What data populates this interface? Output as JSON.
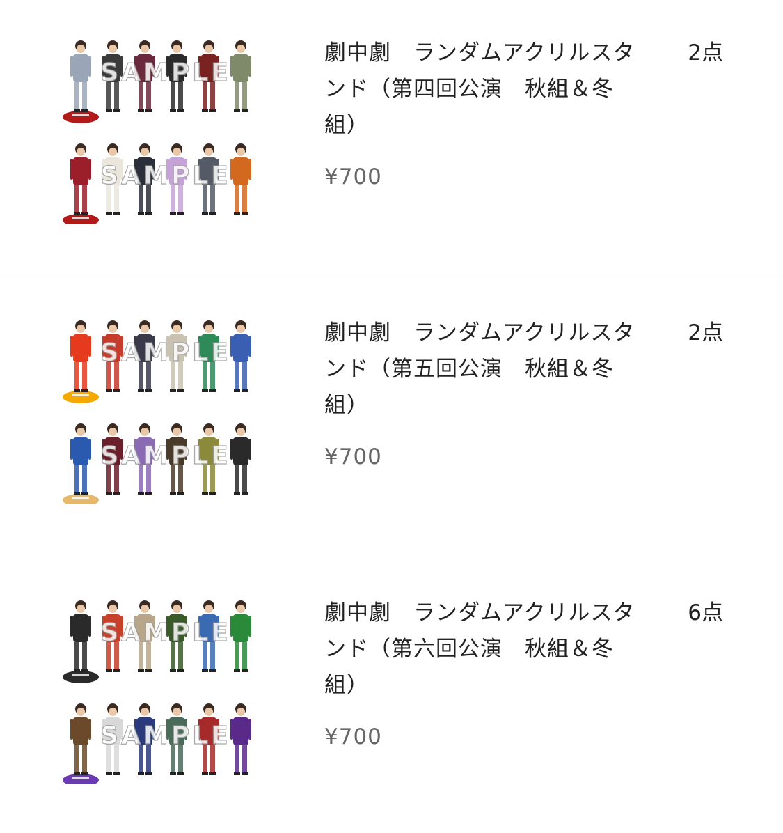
{
  "cart": {
    "items": [
      {
        "title": "劇中劇　ランダムアクリルスタンド（第四回公演　秋組＆冬組）",
        "quantity": "2点",
        "price": "¥700",
        "watermark": "SAMPLE",
        "base_colors": [
          "#b21a1a",
          "#b21a1a"
        ],
        "figure_colors": [
          [
            "#9aa6b8",
            "#3b3b3b",
            "#6b2a3b",
            "#2b2b2b",
            "#7a2222",
            "#7f8a6a"
          ],
          [
            "#9a1f2a",
            "#eae6dc",
            "#2b2f3a",
            "#c5a3d6",
            "#545a66",
            "#d2691e"
          ]
        ]
      },
      {
        "title": "劇中劇　ランダムアクリルスタンド（第五回公演　秋組＆冬組）",
        "quantity": "2点",
        "price": "¥700",
        "watermark": "SAMPLE",
        "base_colors": [
          "#f5a800",
          "#e6b96a"
        ],
        "figure_colors": [
          [
            "#e63a1f",
            "#c63b2b",
            "#3a3a4a",
            "#c9c2b2",
            "#2f8a5a",
            "#3a5fb2"
          ],
          [
            "#2a5ab0",
            "#6a1f2a",
            "#8a6ab2",
            "#4a3a2a",
            "#8a8a3a",
            "#2a2a2a"
          ]
        ]
      },
      {
        "title": "劇中劇　ランダムアクリルスタンド（第六回公演　秋組＆冬組）",
        "quantity": "6点",
        "price": "¥700",
        "watermark": "SAMPLE",
        "base_colors": [
          "#2a2a2a",
          "#6a3ab2"
        ],
        "figure_colors": [
          [
            "#2a2a2a",
            "#c6402a",
            "#b8a68a",
            "#3a5a2a",
            "#3a6ab2",
            "#2a8a3a"
          ],
          [
            "#6a4a2a",
            "#d8d8d8",
            "#2a3a7a",
            "#4a6a5a",
            "#a62a2a",
            "#5a2a8a"
          ]
        ]
      }
    ]
  }
}
